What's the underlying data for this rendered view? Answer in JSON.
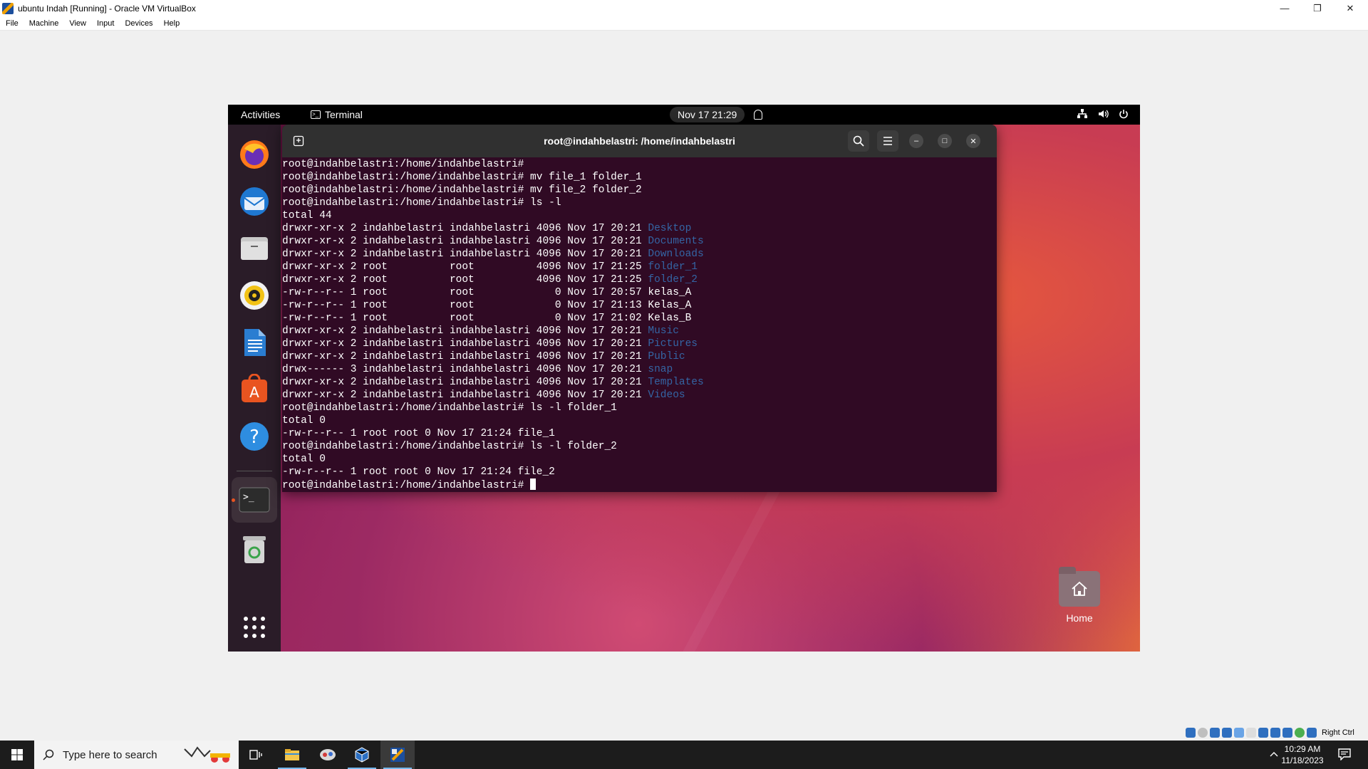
{
  "host_window": {
    "title": "ubuntu Indah [Running] - Oracle VM VirtualBox",
    "controls": {
      "minimize": "—",
      "maximize": "❐",
      "close": "✕"
    }
  },
  "host_menu": [
    "File",
    "Machine",
    "View",
    "Input",
    "Devices",
    "Help"
  ],
  "vm_topbar": {
    "activities": "Activities",
    "app_name": "Terminal",
    "clock": "Nov 17  21:29"
  },
  "terminal": {
    "title": "root@indahbelastri: /home/indahbelastri",
    "lines": [
      [
        {
          "t": "root@indahbelastri:/home/indahbelastri#"
        }
      ],
      [
        {
          "t": "root@indahbelastri:/home/indahbelastri# mv file_1 folder_1"
        }
      ],
      [
        {
          "t": "root@indahbelastri:/home/indahbelastri# mv file_2 folder_2"
        }
      ],
      [
        {
          "t": "root@indahbelastri:/home/indahbelastri# ls -l"
        }
      ],
      [
        {
          "t": "total 44"
        }
      ],
      [
        {
          "t": "drwxr-xr-x 2 indahbelastri indahbelastri 4096 Nov 17 20:21 "
        },
        {
          "t": "Desktop",
          "dir": true
        }
      ],
      [
        {
          "t": "drwxr-xr-x 2 indahbelastri indahbelastri 4096 Nov 17 20:21 "
        },
        {
          "t": "Documents",
          "dir": true
        }
      ],
      [
        {
          "t": "drwxr-xr-x 2 indahbelastri indahbelastri 4096 Nov 17 20:21 "
        },
        {
          "t": "Downloads",
          "dir": true
        }
      ],
      [
        {
          "t": "drwxr-xr-x 2 root          root          4096 Nov 17 21:25 "
        },
        {
          "t": "folder_1",
          "dir": true
        }
      ],
      [
        {
          "t": "drwxr-xr-x 2 root          root          4096 Nov 17 21:25 "
        },
        {
          "t": "folder_2",
          "dir": true
        }
      ],
      [
        {
          "t": "-rw-r--r-- 1 root          root             0 Nov 17 20:57 kelas_A"
        }
      ],
      [
        {
          "t": "-rw-r--r-- 1 root          root             0 Nov 17 21:13 Kelas_A"
        }
      ],
      [
        {
          "t": "-rw-r--r-- 1 root          root             0 Nov 17 21:02 Kelas_B"
        }
      ],
      [
        {
          "t": "drwxr-xr-x 2 indahbelastri indahbelastri 4096 Nov 17 20:21 "
        },
        {
          "t": "Music",
          "dir": true
        }
      ],
      [
        {
          "t": "drwxr-xr-x 2 indahbelastri indahbelastri 4096 Nov 17 20:21 "
        },
        {
          "t": "Pictures",
          "dir": true
        }
      ],
      [
        {
          "t": "drwxr-xr-x 2 indahbelastri indahbelastri 4096 Nov 17 20:21 "
        },
        {
          "t": "Public",
          "dir": true
        }
      ],
      [
        {
          "t": "drwx------ 3 indahbelastri indahbelastri 4096 Nov 17 20:21 "
        },
        {
          "t": "snap",
          "dir": true
        }
      ],
      [
        {
          "t": "drwxr-xr-x 2 indahbelastri indahbelastri 4096 Nov 17 20:21 "
        },
        {
          "t": "Templates",
          "dir": true
        }
      ],
      [
        {
          "t": "drwxr-xr-x 2 indahbelastri indahbelastri 4096 Nov 17 20:21 "
        },
        {
          "t": "Videos",
          "dir": true
        }
      ],
      [
        {
          "t": "root@indahbelastri:/home/indahbelastri# ls -l folder_1"
        }
      ],
      [
        {
          "t": "total 0"
        }
      ],
      [
        {
          "t": "-rw-r--r-- 1 root root 0 Nov 17 21:24 file_1"
        }
      ],
      [
        {
          "t": "root@indahbelastri:/home/indahbelastri# ls -l folder_2"
        }
      ],
      [
        {
          "t": "total 0"
        }
      ],
      [
        {
          "t": "-rw-r--r-- 1 root root 0 Nov 17 21:24 file_2"
        }
      ],
      [
        {
          "t": "root@indahbelastri:/home/indahbelastri# "
        },
        {
          "cursor": true
        }
      ]
    ],
    "colors": {
      "background": "#300a24",
      "directory": "#3465a4",
      "text": "#ffffff"
    }
  },
  "dock_items": [
    "firefox-icon",
    "thunderbird-icon",
    "files-icon",
    "rhythmbox-icon",
    "writer-icon",
    "app-center-icon",
    "help-icon",
    "terminal-icon",
    "trash-icon",
    "show-apps-icon"
  ],
  "desktop": {
    "home_label": "Home"
  },
  "taskbar": {
    "search_placeholder": "Type here to search",
    "time": "10:29 AM",
    "date": "11/18/2023"
  },
  "vbox_status": {
    "host_key": "Right Ctrl"
  }
}
